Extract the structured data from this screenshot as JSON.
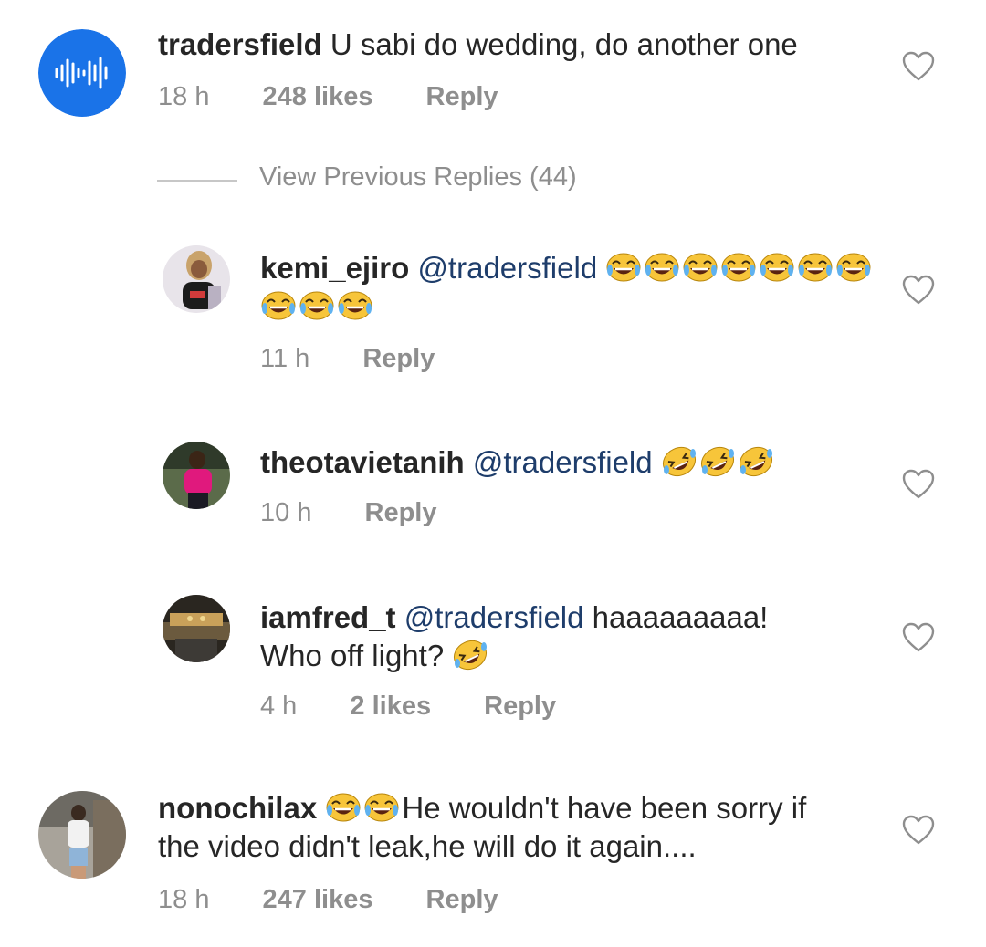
{
  "thread": {
    "parent": {
      "username": "tradersfield",
      "text": "U sabi do wedding, do another one",
      "time": "18 h",
      "likes": "248 likes",
      "reply_label": "Reply"
    },
    "view_previous": "View Previous Replies (44)",
    "replies": [
      {
        "username": "kemi_ejiro",
        "mention": "@tradersfield",
        "text": "",
        "emoji": "grinning-sweat-emoji",
        "emoji_count": 10,
        "time": "11 h",
        "reply_label": "Reply"
      },
      {
        "username": "theotavietanih",
        "mention": "@tradersfield",
        "text": "",
        "emoji": "rofl-emoji",
        "emoji_count": 3,
        "time": "10 h",
        "reply_label": "Reply"
      },
      {
        "username": "iamfred_t",
        "mention": "@tradersfield",
        "text_line1": "haaaaaaaaa!",
        "text_line2": "Who off light?",
        "emoji": "rofl-emoji",
        "emoji_count": 1,
        "time": "4 h",
        "likes": "2 likes",
        "reply_label": "Reply"
      }
    ],
    "next_comment": {
      "username": "nonochilax",
      "emoji": "grinning-sweat-emoji",
      "emoji_count": 2,
      "text_line1": "He wouldn't have been sorry if",
      "text_line2": "the video didn't leak,he will do it again....",
      "time": "18 h",
      "likes": "247 likes",
      "reply_label": "Reply"
    }
  },
  "colors": {
    "mention": "#1e3d6b",
    "meta": "#8e8e8e",
    "avatar_blue": "#1a73e8",
    "emoji_yellow": "#f7c53a"
  },
  "icons": {
    "like": "heart-outline-icon",
    "waveform": "sound-wave-icon"
  }
}
